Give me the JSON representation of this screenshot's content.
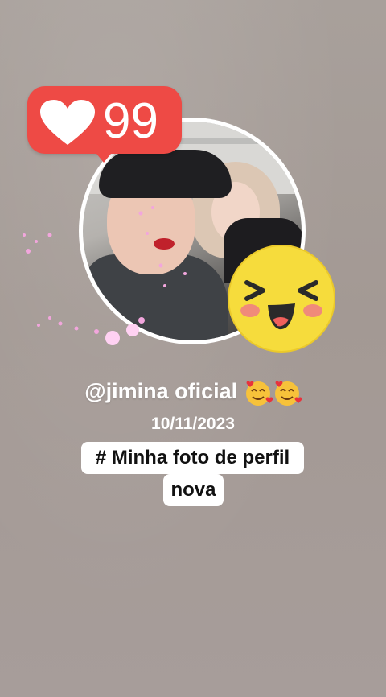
{
  "notification": {
    "like_count": "99",
    "icon": "heart-icon",
    "color": "#ee4a45"
  },
  "profile": {
    "username": "@jimina oficial",
    "emojis": "smiling-face-with-hearts x2",
    "date": "10/11/2023",
    "caption_line1": "# Minha foto de perfil",
    "caption_line2": "nova"
  },
  "stickers": {
    "face": "laughing-emoji-icon",
    "face_color": "#f6dc3c"
  }
}
